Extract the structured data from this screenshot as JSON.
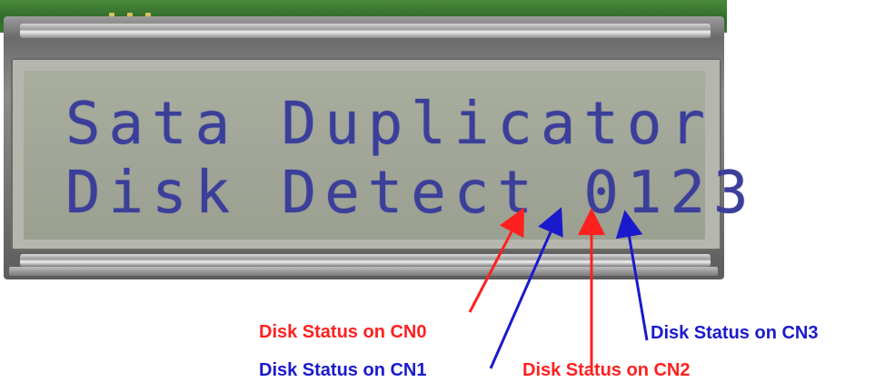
{
  "lcd": {
    "line1": "Sata Duplicator",
    "line2": "Disk Detect 0123"
  },
  "annotations": [
    {
      "text": "Disk Status on CN0",
      "color": "#ff2020"
    },
    {
      "text": "Disk Status on CN1",
      "color": "#1a1acc"
    },
    {
      "text": "Disk Status on CN2",
      "color": "#ff2020"
    },
    {
      "text": "Disk Status on CN3",
      "color": "#1a1acc"
    }
  ]
}
